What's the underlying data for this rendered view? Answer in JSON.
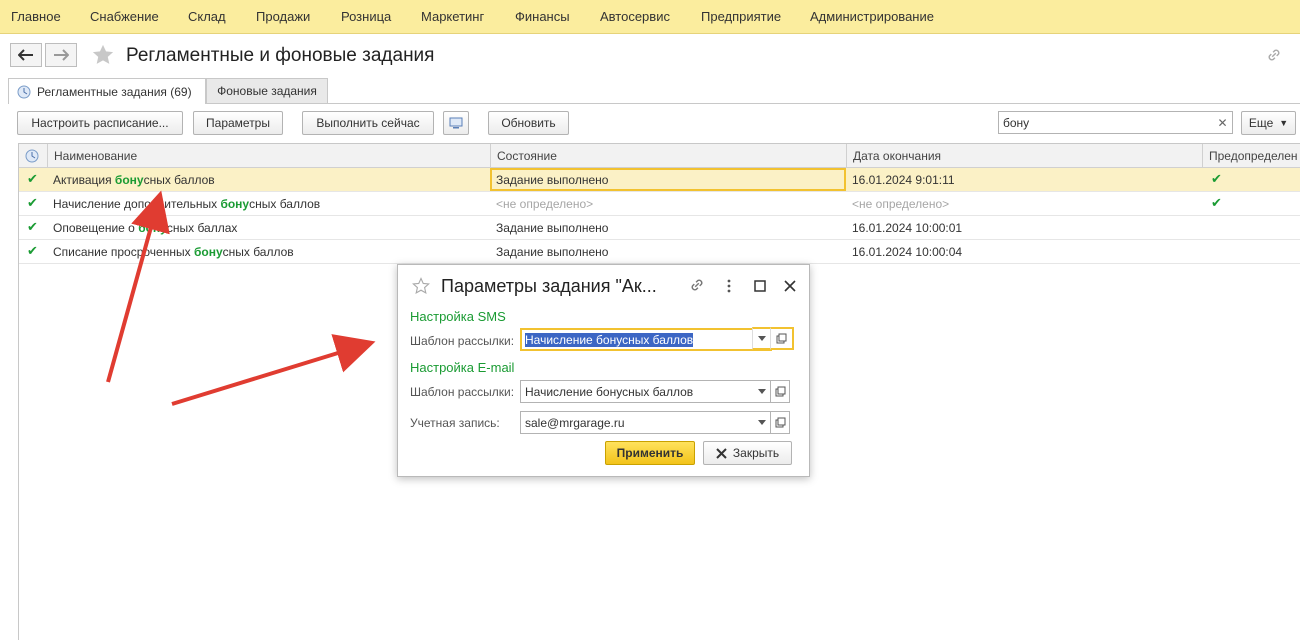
{
  "menu": [
    "Главное",
    "Снабжение",
    "Склад",
    "Продажи",
    "Розница",
    "Маркетинг",
    "Финансы",
    "Автосервис",
    "Предприятие",
    "Администрирование"
  ],
  "window": {
    "title": "Регламентные и фоновые задания"
  },
  "tabs": [
    {
      "label": "Регламентные задания (69)",
      "active": true
    },
    {
      "label": "Фоновые задания",
      "active": false
    }
  ],
  "toolbar": {
    "schedule_label": "Настроить расписание...",
    "params_label": "Параметры",
    "run_now_label": "Выполнить сейчас",
    "refresh_label": "Обновить",
    "search_value": "бону",
    "more_label": "Еще"
  },
  "table": {
    "columns": [
      "Наименование",
      "Состояние",
      "Дата окончания",
      "Предопределен"
    ],
    "rows": [
      {
        "name_pre": "Активация ",
        "name_hl": "бону",
        "name_post": "сных баллов",
        "state": "Задание выполнено",
        "end": "16.01.2024 9:01:11",
        "predefined": true,
        "selected": true
      },
      {
        "name_pre": "Начисление дополнительных ",
        "name_hl": "бону",
        "name_post": "сных баллов",
        "state": "<не определено>",
        "end": "<не определено>",
        "predefined": true,
        "selected": false
      },
      {
        "name_pre": "Оповещение о ",
        "name_hl": "бону",
        "name_post": "сных баллах",
        "state": "Задание выполнено",
        "end": "16.01.2024 10:00:01",
        "predefined": false,
        "selected": false
      },
      {
        "name_pre": "Списание просроченных ",
        "name_hl": "бону",
        "name_post": "сных баллов",
        "state": "Задание выполнено",
        "end": "16.01.2024 10:00:04",
        "predefined": false,
        "selected": false
      }
    ]
  },
  "dialog": {
    "title": "Параметры задания \"Ак...",
    "sms_group": "Настройка SMS",
    "sms_template_label": "Шаблон рассылки:",
    "sms_template_value": "Начисление бонусных баллов",
    "email_group": "Настройка E-mail",
    "email_template_label": "Шаблон рассылки:",
    "email_template_value": "Начисление бонусных баллов",
    "account_label": "Учетная запись:",
    "account_value": "sale@mrgarage.ru",
    "apply_label": "Применить",
    "close_label": "Закрыть"
  },
  "colors": {
    "menu_bg": "#fbed9e",
    "accent_green": "#1a9b33",
    "arrow_red": "#e03c31",
    "apply_yellow": "#f2c31a"
  }
}
